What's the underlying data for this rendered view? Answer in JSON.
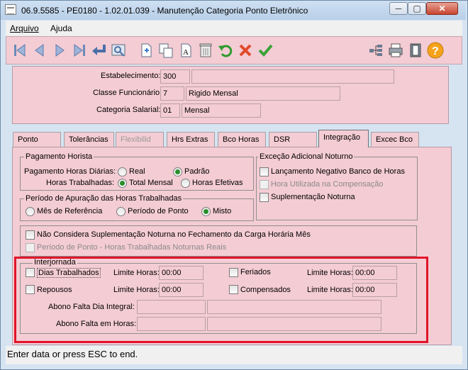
{
  "window": {
    "title": "06.9.5585 - PE0180 - 1.02.01.039 - Manutenção Categoria Ponto Eletrônico",
    "controls": [
      "─",
      "▢",
      "✕"
    ]
  },
  "menu": {
    "arquivo": "Arquivo",
    "ajuda": "Ajuda"
  },
  "toolbar": {
    "left_icons": [
      "first-record-icon",
      "previous-record-icon",
      "next-record-icon",
      "last-record-icon",
      "return-icon",
      "zoom-icon",
      "new-record-icon",
      "copy-icon",
      "edit-text-icon",
      "delete-icon",
      "undo-icon",
      "cancel-icon",
      "confirm-icon"
    ],
    "right_icons": [
      "tree-icon",
      "print-icon",
      "exit-icon",
      "help-icon"
    ]
  },
  "header": {
    "estabelecimento_label": "Estabelecimento:",
    "estabelecimento_code": "300",
    "estabelecimento_desc": "",
    "classe_label": "Classe Funcionário:",
    "classe_code": "7",
    "classe_desc": "Rigido Mensal",
    "categoria_label": "Categoria Salarial:",
    "categoria_code": "01",
    "categoria_desc": "Mensal"
  },
  "tabs": [
    {
      "label": "Ponto",
      "state": "normal"
    },
    {
      "label": "Tolerâncias",
      "state": "normal"
    },
    {
      "label": "Flexibilid",
      "state": "disabled"
    },
    {
      "label": "Hrs Extras",
      "state": "normal"
    },
    {
      "label": "Bco Horas",
      "state": "normal"
    },
    {
      "label": "DSR",
      "state": "normal"
    },
    {
      "label": "Integração",
      "state": "active"
    },
    {
      "label": "Excec Bco",
      "state": "normal"
    }
  ],
  "pagamento": {
    "title": "Pagamento Horista",
    "diarias_label": "Pagamento Horas Diárias:",
    "real": "Real",
    "padrao": "Padrão",
    "trabalhadas_label": "Horas Trabalhadas:",
    "total_mensal": "Total Mensal",
    "horas_efetivas": "Horas Efetivas"
  },
  "excecao": {
    "title": "Exceção Adicional Noturno",
    "lancamento": "Lançamento Negativo Banco de Horas",
    "hora_utilizada": "Hora Utilizada na Compensação",
    "suplementacao": "Suplementação Noturna"
  },
  "periodo": {
    "title": "Período de Apuração das Horas Trabalhadas",
    "mes_referencia": "Mês de Referência",
    "periodo_ponto": "Período de Ponto",
    "misto": "Misto"
  },
  "opcoes": {
    "nao_considera": "Não Considera Suplementação Noturna no Fechamento da Carga Horária Mês",
    "periodo_ponto_reais": "Período de Ponto - Horas Trabalhadas Noturnas Reais"
  },
  "interjornada": {
    "title": "Interjornada",
    "dias_trabalhados": "Dias Trabalhados",
    "repousos": "Repousos",
    "feriados": "Feriados",
    "compensados": "Compensados",
    "limite_label": "Limite Horas:",
    "limite_dias": "00:00",
    "limite_repousos": "00:00",
    "limite_feriados": "00:00",
    "limite_compensados": "00:00",
    "abono_integral_label": "Abono Falta Dia Integral:",
    "abono_horas_label": "Abono Falta em Horas:"
  },
  "status": {
    "text": "Enter data or press ESC to end."
  },
  "colors": {
    "panel": "#f4ccd4",
    "highlight": "#e0142a",
    "frame": "#d6e4f2"
  }
}
